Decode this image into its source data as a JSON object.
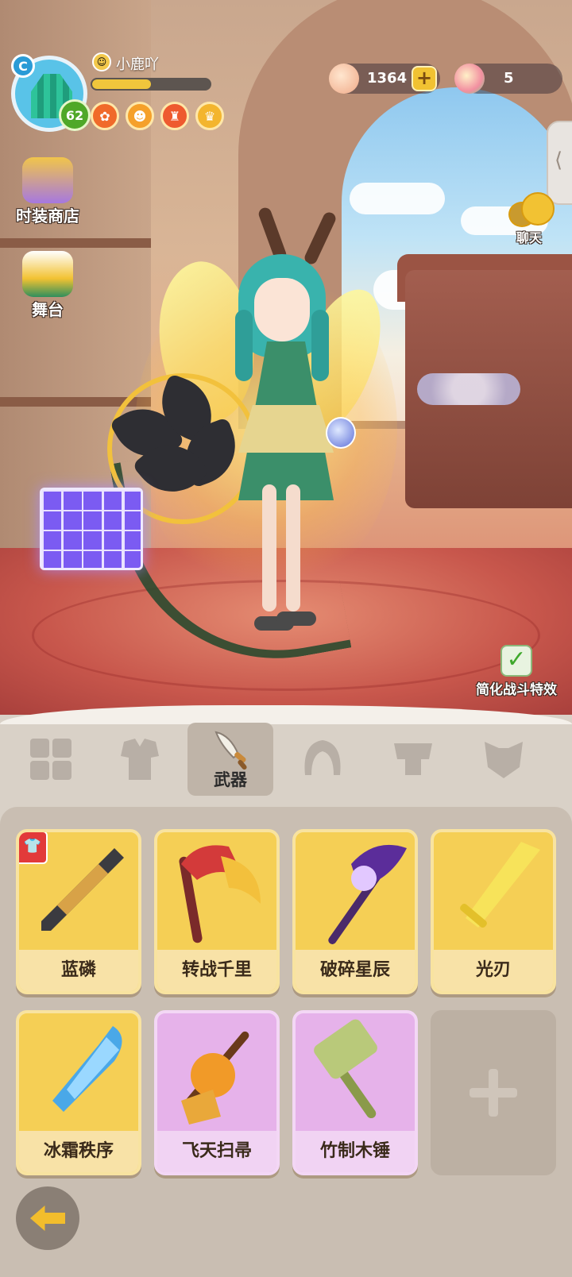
{
  "player": {
    "name": "小鹿吖",
    "level": "62",
    "exp_fraction": 0.5,
    "avatar_badge": "C",
    "status_icons": [
      {
        "name": "buff-paw-icon",
        "color": "#f06a2a"
      },
      {
        "name": "buff-face-icon",
        "color": "#f5a02a"
      },
      {
        "name": "buff-crest-icon",
        "color": "#ee5a2f"
      },
      {
        "name": "buff-crown-icon",
        "color": "#f3b52e"
      }
    ]
  },
  "currency": {
    "shells": "1364",
    "gems": "5"
  },
  "side_menu": {
    "shop_label": "时装商店",
    "stage_label": "舞台"
  },
  "chat": {
    "label": "聊天",
    "collapse_glyph": "⟨"
  },
  "battle_fx": {
    "label": "简化战斗特效",
    "checked": true
  },
  "tabs": {
    "active_label": "武器",
    "items": [
      "suit-tab",
      "outfit-tab",
      "weapon-tab",
      "hair-tab",
      "face-tab",
      "accessory-tab"
    ]
  },
  "weapons": [
    {
      "name": "蓝磷",
      "rarity": "gold",
      "equipped": true,
      "icon": "dark-blade-icon"
    },
    {
      "name": "转战千里",
      "rarity": "gold",
      "equipped": false,
      "icon": "dragon-scythe-icon"
    },
    {
      "name": "破碎星辰",
      "rarity": "gold",
      "equipped": false,
      "icon": "star-staff-icon"
    },
    {
      "name": "光刃",
      "rarity": "gold",
      "equipped": false,
      "icon": "light-sword-icon"
    },
    {
      "name": "冰霜秩序",
      "rarity": "gold",
      "equipped": false,
      "icon": "frost-blade-icon"
    },
    {
      "name": "飞天扫帚",
      "rarity": "purple",
      "equipped": false,
      "icon": "pumpkin-broom-icon"
    },
    {
      "name": "竹制木锤",
      "rarity": "purple",
      "equipped": false,
      "icon": "bamboo-hammer-icon"
    }
  ],
  "colors": {
    "gold_card": "#f5cf55",
    "purple_card": "#e6b2ea",
    "accent_yellow": "#f2bd2c"
  }
}
